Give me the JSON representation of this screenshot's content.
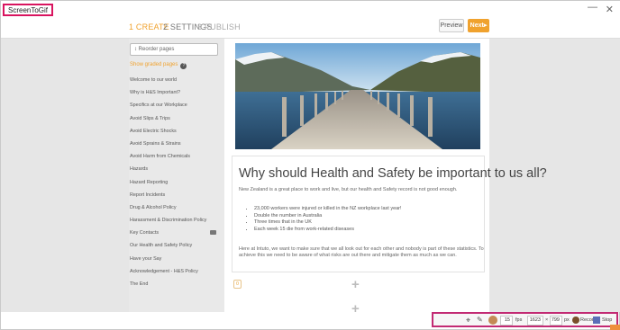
{
  "window": {
    "app_logo_text": "ScreenToGif",
    "close_glyph": "✕",
    "minimize_glyph": "—"
  },
  "topnav": {
    "steps": [
      {
        "number": "1",
        "label": "CREATE"
      },
      {
        "number": "2",
        "label": "SETTINGS"
      },
      {
        "number": "3",
        "label": "PUBLISH"
      }
    ],
    "preview_label": "Preview",
    "next_label": "Next▸"
  },
  "sidebar": {
    "reorder_label": "↕ Reorder pages",
    "show_graded_label": "Show graded pages",
    "help_glyph": "?",
    "items": [
      "Welcome to our world",
      "Why is H&S Important?",
      "Specifics at our Workplace",
      "Avoid Slips & Trips",
      "Avoid Electric Shocks",
      "Avoid Sprains & Strains",
      "Avoid Harm from Chemicals",
      "Hazards",
      "Hazard Reporting",
      "Report Incidents",
      "Drug & Alcohol Policy",
      "Harassment & Discrimination Policy",
      "Key Contacts",
      "Our Health and Safety Policy",
      "Have your Say",
      "Acknowledgement - H&S Policy",
      "The End"
    ]
  },
  "main": {
    "heading": "Why should Health and Safety be important to us all?",
    "intro": "New Zealand is a great place to work and live, but our health and Safety record is not good enough.",
    "bullets": [
      "23,000 workers were injured or killed in the NZ workplace last year!",
      "Double the number in Australia",
      "Three times that in the UK",
      "Each week 15 die from work-related diseases"
    ],
    "outro": "Here at Intuto, we want to make sure that we all look out for each other and nobody is part of these statistics. To achieve this we need to be aware of what risks are out there and mitigate them as much as we can.",
    "badge_value": "0",
    "add_glyph": "+"
  },
  "recorder": {
    "fps_value": "15",
    "fps_label": "fps",
    "width_value": "1623",
    "times_glyph": "×",
    "height_value": "799",
    "px_label": "px",
    "record_label": "Record",
    "stop_label": "Stop"
  },
  "colors": {
    "accent": "#f0a22e",
    "recorder_border": "#c22a73",
    "logo_border": "#d9145f"
  }
}
